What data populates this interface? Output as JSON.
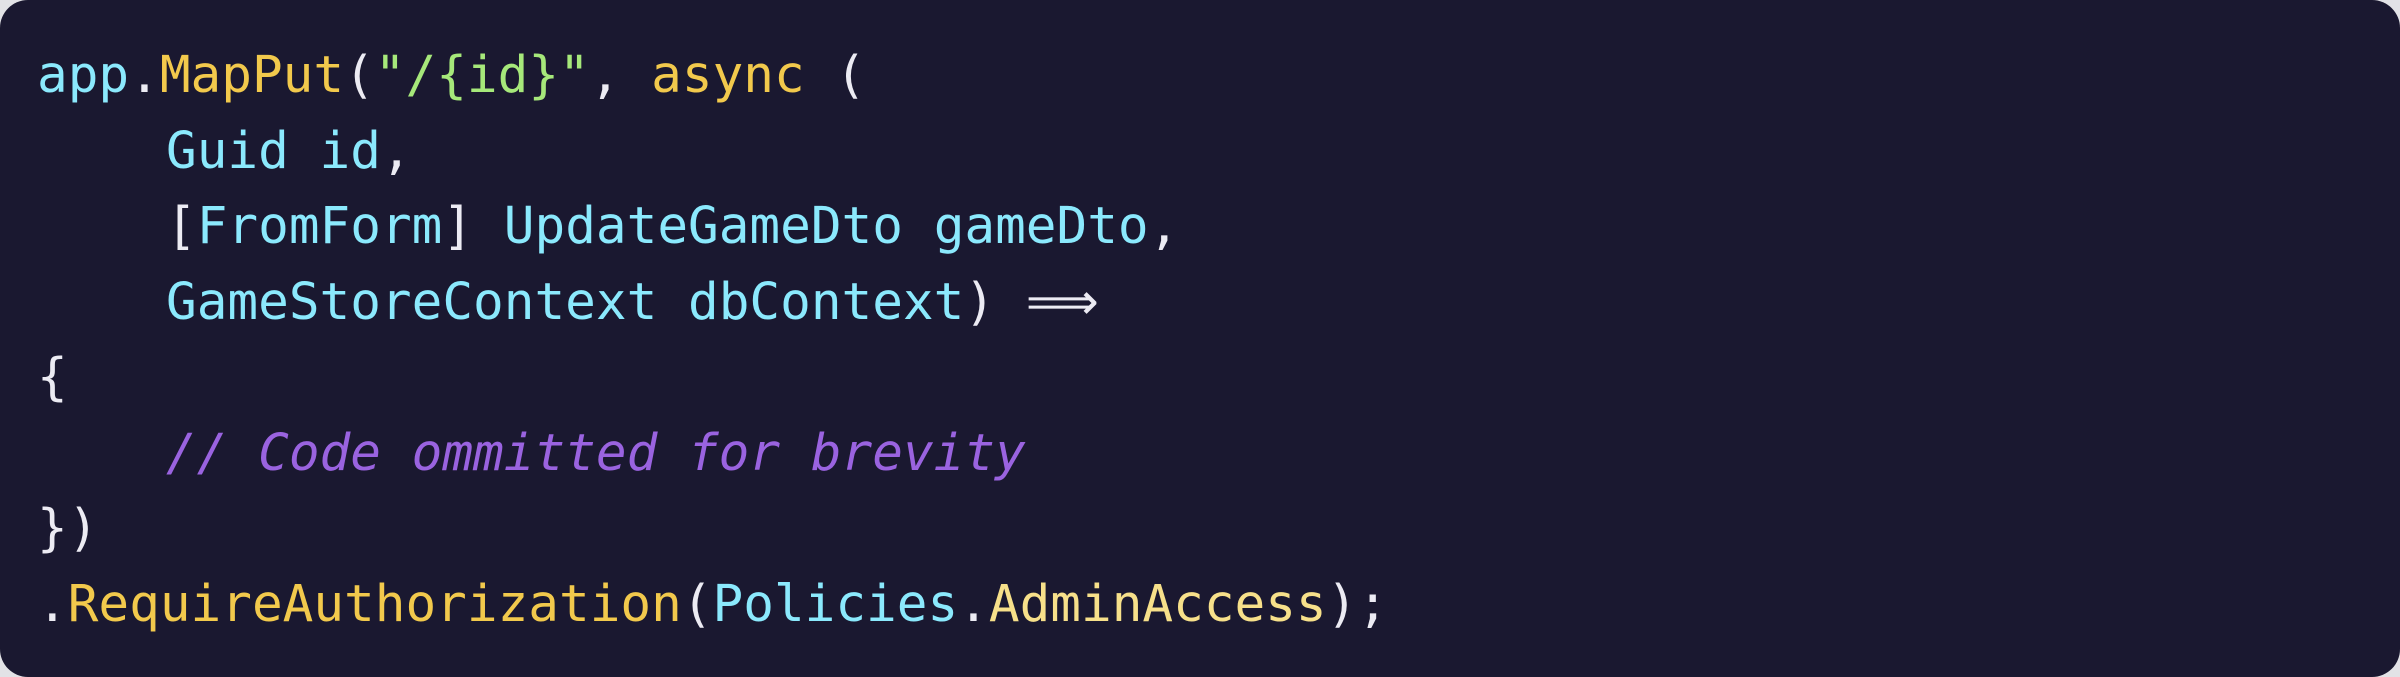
{
  "colors": {
    "background": "#1a1830",
    "identifier": "#8be9fd",
    "method": "#f2c94c",
    "string": "#a6e87a",
    "punctuation": "#ecebf3",
    "member": "#f7e08a",
    "comment": "#9a63e0"
  },
  "code": {
    "line1": {
      "obj": "app",
      "dot": ".",
      "method": "MapPut",
      "open": "(",
      "route": "\"/{id}\"",
      "comma": ",",
      "keyword": "async",
      "paren": "("
    },
    "line2": {
      "type": "Guid",
      "param": "id",
      "comma": ","
    },
    "line3": {
      "open_bracket": "[",
      "attribute": "FromForm",
      "close_bracket": "]",
      "type": "UpdateGameDto",
      "param": "gameDto",
      "comma": ","
    },
    "line4": {
      "type": "GameStoreContext",
      "param": "dbContext",
      "close": ")",
      "arrow": "⟹"
    },
    "line5": {
      "brace": "{"
    },
    "line6": {
      "comment": "// Code ommitted for brevity"
    },
    "line7": {
      "close": "})"
    },
    "line8": {
      "dot": ".",
      "method": "RequireAuthorization",
      "open": "(",
      "class": "Policies",
      "dot2": ".",
      "member": "AdminAccess",
      "close": ");"
    }
  }
}
